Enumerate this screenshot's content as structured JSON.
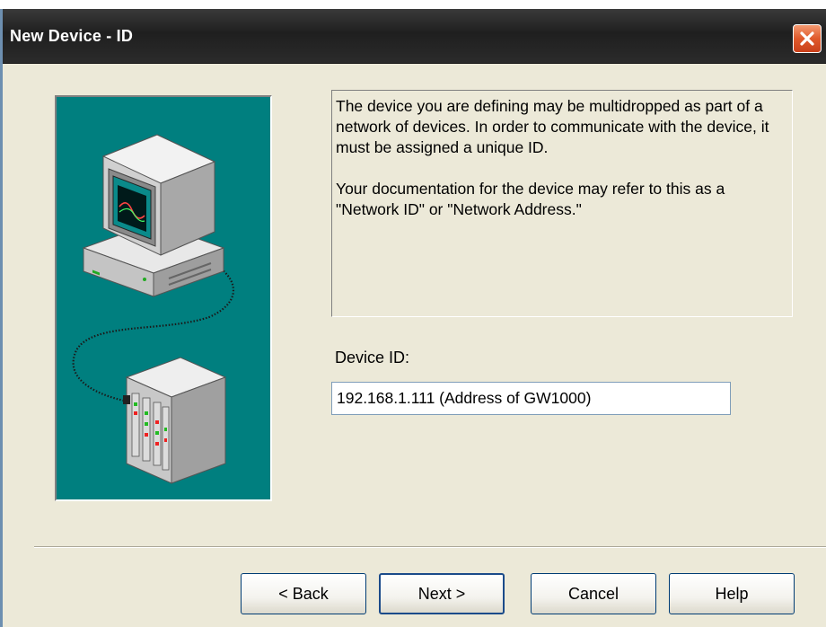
{
  "window": {
    "title": "New Device - ID"
  },
  "info": {
    "paragraph1": "The device you are defining may be multidropped as part of a network of devices.  In order to communicate with the device, it must be assigned a unique ID.",
    "paragraph2": "Your documentation for the device may refer to this as a \"Network ID\" or \"Network Address.\""
  },
  "device_id": {
    "label": "Device ID:",
    "value": "192.168.1.111 (Address of GW1000)"
  },
  "buttons": {
    "back": "< Back",
    "next": "Next >",
    "cancel": "Cancel",
    "help": "Help"
  },
  "colors": {
    "illustration_background": "#007f7f",
    "dialog_background": "#ece9d8",
    "close_button": "#e0592b"
  }
}
